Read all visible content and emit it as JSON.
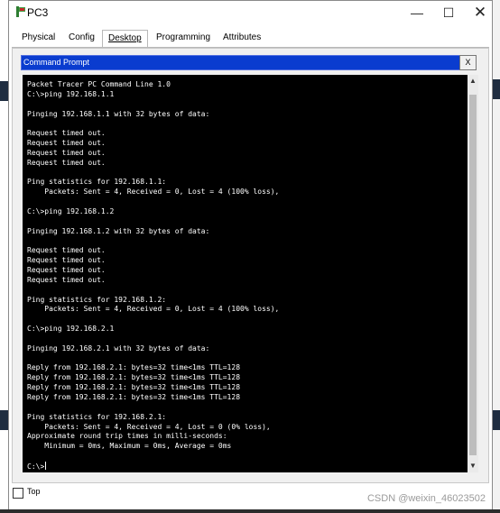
{
  "window": {
    "title": "PC3",
    "controls": {
      "minimize": "—",
      "maximize": "☐",
      "close": "✕"
    },
    "colors": {
      "title_icon": "#2e7d32",
      "cmd_header": "#0a3ccf",
      "terminal_bg": "#000000"
    }
  },
  "tabs": [
    {
      "label": "Physical",
      "active": false
    },
    {
      "label": "Config",
      "active": false
    },
    {
      "label": "Desktop",
      "active": true
    },
    {
      "label": "Programming",
      "active": false
    },
    {
      "label": "Attributes",
      "active": false
    }
  ],
  "cmd": {
    "title": "Command Prompt",
    "close_label": "X",
    "lines": [
      "Packet Tracer PC Command Line 1.0",
      "C:\\>ping 192.168.1.1",
      "",
      "Pinging 192.168.1.1 with 32 bytes of data:",
      "",
      "Request timed out.",
      "Request timed out.",
      "Request timed out.",
      "Request timed out.",
      "",
      "Ping statistics for 192.168.1.1:",
      "    Packets: Sent = 4, Received = 0, Lost = 4 (100% loss),",
      "",
      "C:\\>ping 192.168.1.2",
      "",
      "Pinging 192.168.1.2 with 32 bytes of data:",
      "",
      "Request timed out.",
      "Request timed out.",
      "Request timed out.",
      "Request timed out.",
      "",
      "Ping statistics for 192.168.1.2:",
      "    Packets: Sent = 4, Received = 0, Lost = 4 (100% loss),",
      "",
      "C:\\>ping 192.168.2.1",
      "",
      "Pinging 192.168.2.1 with 32 bytes of data:",
      "",
      "Reply from 192.168.2.1: bytes=32 time<1ms TTL=128",
      "Reply from 192.168.2.1: bytes=32 time<1ms TTL=128",
      "Reply from 192.168.2.1: bytes=32 time<1ms TTL=128",
      "Reply from 192.168.2.1: bytes=32 time<1ms TTL=128",
      "",
      "Ping statistics for 192.168.2.1:",
      "    Packets: Sent = 4, Received = 4, Lost = 0 (0% loss),",
      "Approximate round trip times in milli-seconds:",
      "    Minimum = 0ms, Maximum = 0ms, Average = 0ms",
      ""
    ],
    "prompt": "C:\\>"
  },
  "scrollbar": {
    "up": "▲",
    "down": "▼"
  },
  "footer": {
    "top_checkbox_label": "Top",
    "top_checked": false
  },
  "watermark": "CSDN @weixin_46023502"
}
